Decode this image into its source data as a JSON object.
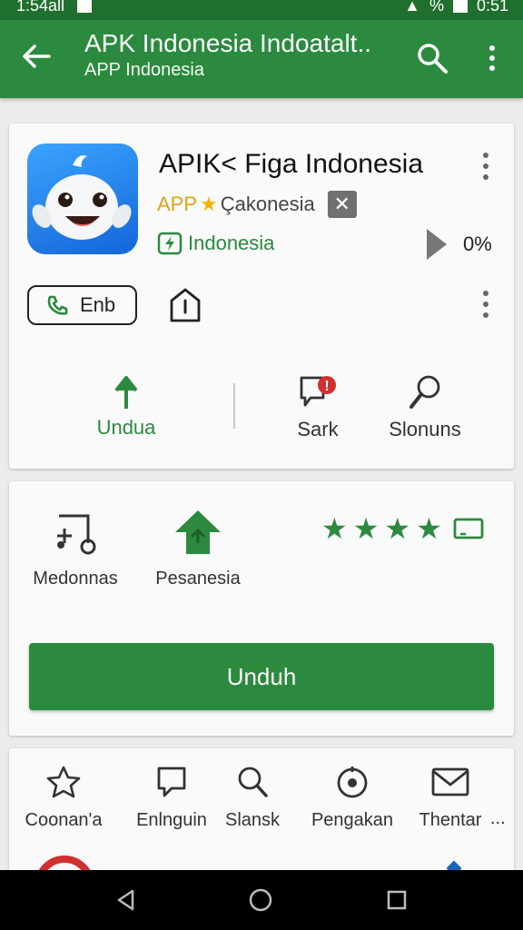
{
  "status_bar": {
    "left_text": "1:54all",
    "right_text": "%",
    "time": "0:51"
  },
  "app_bar": {
    "title": "APK Indonesia Indoatalt..",
    "subtitle": "APP Indonesia",
    "icons": [
      "back-arrow-icon",
      "search-icon",
      "more-vert-icon"
    ]
  },
  "app_card": {
    "name": "APIK< Figa Indonesia",
    "tag_app": "APP",
    "developer": "Çakonesia",
    "close_symbol": "✕",
    "category": "Indonesia",
    "percent": "0%",
    "pill_label": "Enb",
    "actions": [
      {
        "label": "Undua",
        "icon": "download-arrow-icon"
      },
      {
        "label": "Sark",
        "icon": "chat-bubble-icon",
        "badge": "!"
      },
      {
        "label": "Slonuns",
        "icon": "magnifier-icon"
      }
    ]
  },
  "features_card": {
    "items": [
      {
        "label": "Medonnas",
        "icon": "tools-icon"
      },
      {
        "label": "Pesanesia",
        "icon": "house-upload-icon"
      }
    ],
    "rating": 4,
    "install_button": "Unduh"
  },
  "bottom_nav": {
    "items": [
      {
        "label": "Coonan'a",
        "icon": "star-outline-icon"
      },
      {
        "label": "Enlnguin",
        "icon": "message-icon"
      },
      {
        "label": "Slansk",
        "icon": "search-icon"
      },
      {
        "label": "Pengakan",
        "icon": "target-icon"
      },
      {
        "label": "Thentar",
        "icon": "mail-icon"
      }
    ],
    "more": "..."
  },
  "colors": {
    "primary": "#2b8a3e",
    "primary_dark": "#1f6f2e",
    "accent_star": "#f2b600",
    "badge_red": "#d32f2f"
  }
}
